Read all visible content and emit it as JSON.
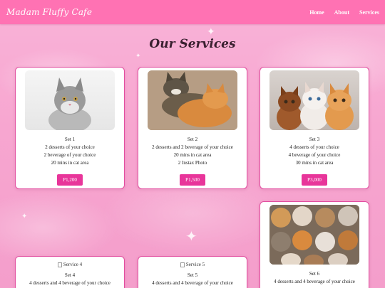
{
  "nav": {
    "brand": "Madam Fluffy Cafe",
    "links": [
      "Home",
      "About",
      "Services"
    ]
  },
  "page_title": "Our Services",
  "cards": [
    {
      "title": "Set 1",
      "lines": [
        "2 desserts of your choice",
        "2 beverage of your choice",
        "20 mins in cat area"
      ],
      "price": "P1,200",
      "image_alt": ""
    },
    {
      "title": "Set 2",
      "lines": [
        "2 desserts and 2 beverage of your choice",
        "20 mins in cat area",
        "2 Instax Photo"
      ],
      "price": "P1,500",
      "image_alt": ""
    },
    {
      "title": "Set 3",
      "lines": [
        "4 desserts of your choice",
        "4 beverage of your choice",
        "30 mins in cat area"
      ],
      "price": "P3,000",
      "image_alt": ""
    },
    {
      "title": "Set 4",
      "lines": [
        "4 desserts and 4 beverage of your choice"
      ],
      "image_alt": "Service 4"
    },
    {
      "title": "Set 5",
      "lines": [
        "4 desserts and 4 beverage of your choice"
      ],
      "image_alt": "Service 5"
    },
    {
      "title": "Set 6",
      "lines": [
        "4 desserts and 4 beverage of your choice"
      ],
      "image_alt": ""
    }
  ],
  "colors": {
    "navbar": "#ff72b3",
    "button": "#e8359a",
    "card_border": "#e24ea0"
  }
}
